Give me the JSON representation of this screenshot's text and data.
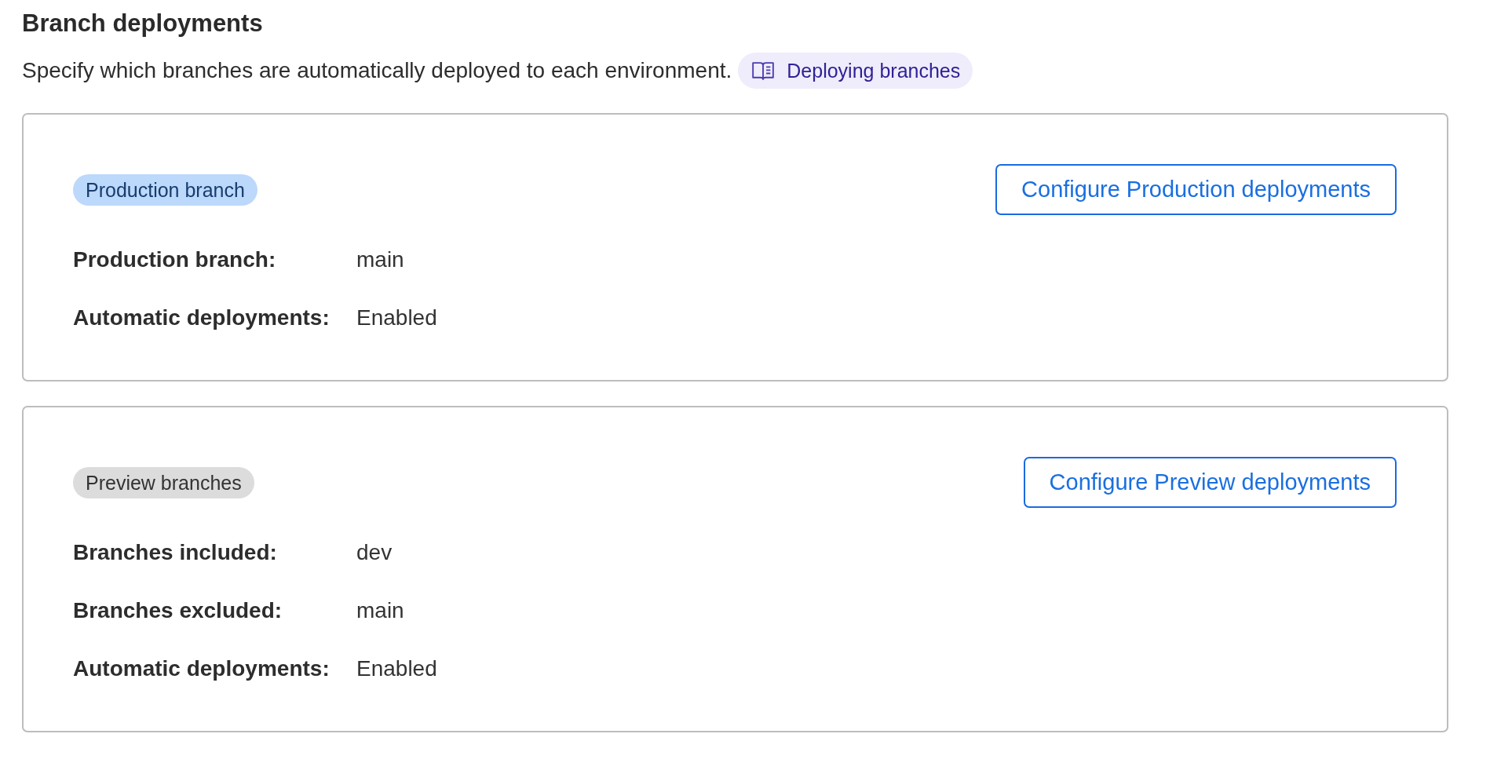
{
  "header": {
    "title": "Branch deployments",
    "description": "Specify which branches are automatically deployed to each environment.",
    "doc_link": {
      "label": "Deploying branches"
    }
  },
  "cards": [
    {
      "badge": {
        "label": "Production branch",
        "kind": "primary"
      },
      "button": {
        "label": "Configure Production deployments"
      },
      "fields": [
        {
          "label": "Production branch:",
          "value": "main"
        },
        {
          "label": "Automatic deployments:",
          "value": "Enabled"
        }
      ]
    },
    {
      "badge": {
        "label": "Preview branches",
        "kind": "neutral"
      },
      "button": {
        "label": "Configure Preview deployments"
      },
      "fields": [
        {
          "label": "Branches included:",
          "value": "dev"
        },
        {
          "label": "Branches excluded:",
          "value": "main"
        },
        {
          "label": "Automatic deployments:",
          "value": "Enabled"
        }
      ]
    }
  ]
}
